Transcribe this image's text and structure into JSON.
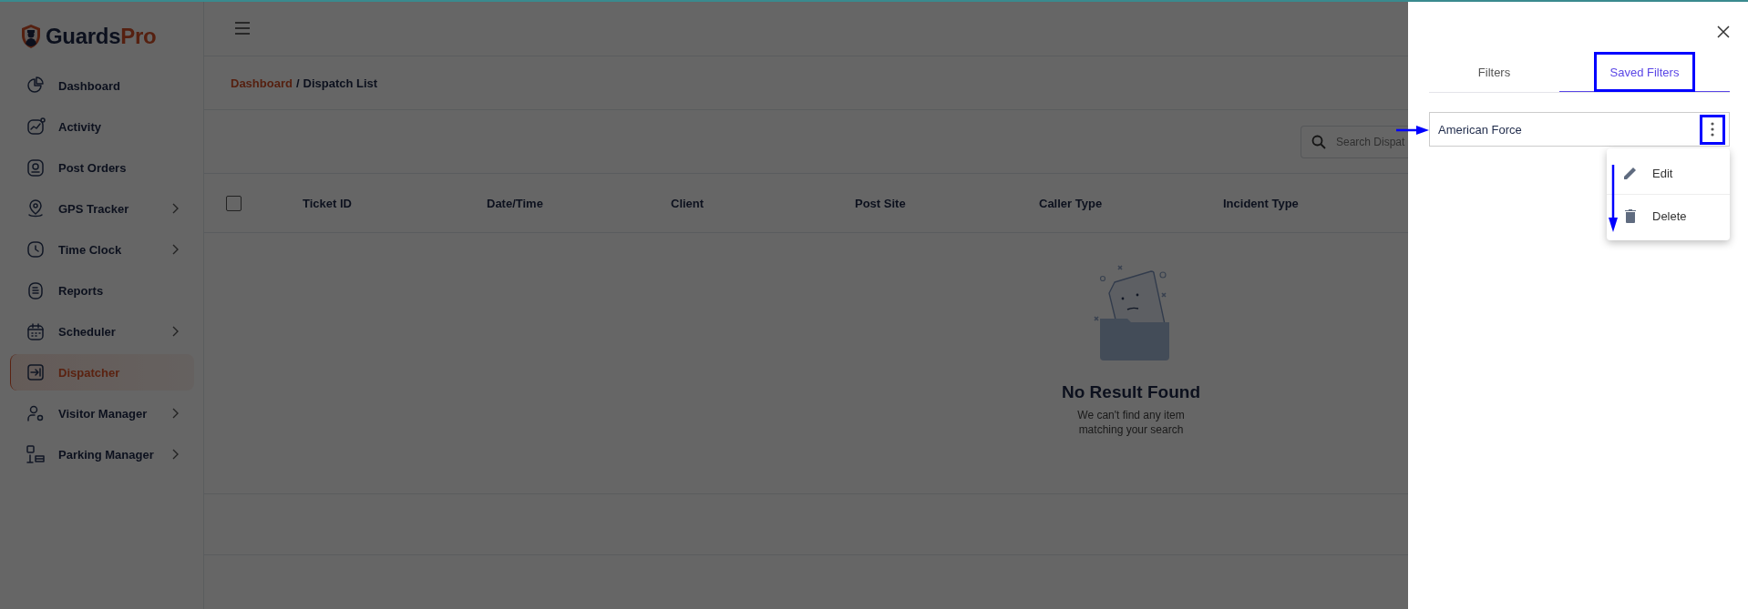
{
  "sidebar": {
    "logo": {
      "name": "Guards",
      "suffix": "Pro"
    },
    "items": [
      {
        "label": "Dashboard",
        "has_submenu": false,
        "selected": false
      },
      {
        "label": "Activity",
        "has_submenu": false,
        "selected": false
      },
      {
        "label": "Post Orders",
        "has_submenu": false,
        "selected": false
      },
      {
        "label": "GPS Tracker",
        "has_submenu": true,
        "selected": false
      },
      {
        "label": "Time Clock",
        "has_submenu": true,
        "selected": false
      },
      {
        "label": "Reports",
        "has_submenu": false,
        "selected": false
      },
      {
        "label": "Scheduler",
        "has_submenu": true,
        "selected": false
      },
      {
        "label": "Dispatcher",
        "has_submenu": false,
        "selected": true
      },
      {
        "label": "Visitor Manager",
        "has_submenu": true,
        "selected": false
      },
      {
        "label": "Parking Manager",
        "has_submenu": true,
        "selected": false
      }
    ]
  },
  "breadcrumb": {
    "items": [
      {
        "label": "Dashboard",
        "link": true
      },
      {
        "label": "Dispatch List",
        "link": false
      }
    ],
    "separator": "/"
  },
  "search": {
    "placeholder": "Search Dispat"
  },
  "table": {
    "select_all": {
      "checked": false
    },
    "columns": [
      "Ticket ID",
      "Date/Time",
      "Client",
      "Post Site",
      "Caller Type",
      "Incident Type"
    ]
  },
  "empty_state": {
    "title": "No Result Found",
    "message": "We can't find any item matching your search"
  },
  "drawer": {
    "tabs": [
      {
        "label": "Filters",
        "selected": false,
        "highlighted": false
      },
      {
        "label": "Saved Filters",
        "selected": true,
        "highlighted": true
      }
    ],
    "saved_filters": [
      {
        "name": "American Force",
        "menu_open": true,
        "highlighted": true
      }
    ],
    "menu": [
      {
        "label": "Edit"
      },
      {
        "label": "Delete"
      }
    ]
  }
}
